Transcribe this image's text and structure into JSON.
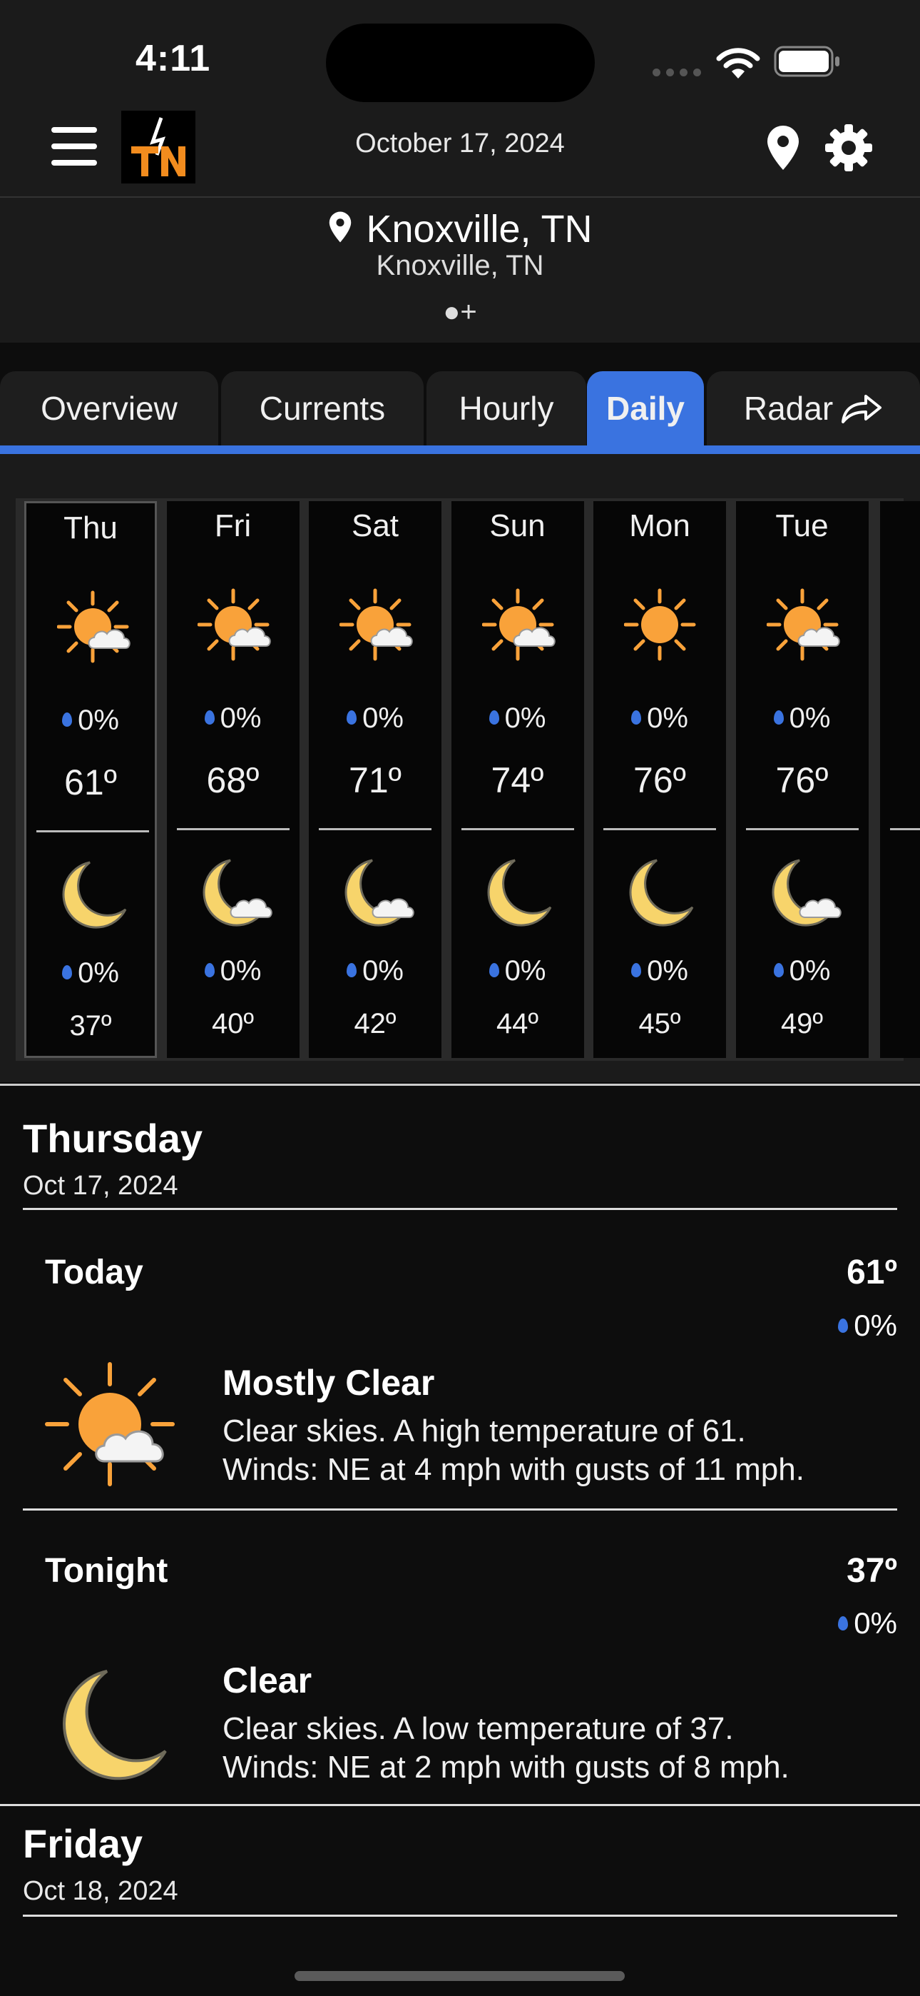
{
  "status": {
    "time": "4:11"
  },
  "header": {
    "date": "October 17, 2024"
  },
  "location": {
    "name": "Knoxville, TN",
    "subname": "Knoxville, TN",
    "pager": "●+"
  },
  "tabs": [
    {
      "label": "Overview",
      "active": false
    },
    {
      "label": "Currents",
      "active": false
    },
    {
      "label": "Hourly",
      "active": false
    },
    {
      "label": "Daily",
      "active": true
    },
    {
      "label": "Radar",
      "active": false
    }
  ],
  "days": [
    {
      "day": "Thu",
      "day_icon": "sun-cloud",
      "day_rain": "0%",
      "high": "61º",
      "night_icon": "moon",
      "night_rain": "0%",
      "low": "37º"
    },
    {
      "day": "Fri",
      "day_icon": "sun-cloud",
      "day_rain": "0%",
      "high": "68º",
      "night_icon": "moon-cloud",
      "night_rain": "0%",
      "low": "40º"
    },
    {
      "day": "Sat",
      "day_icon": "sun-cloud",
      "day_rain": "0%",
      "high": "71º",
      "night_icon": "moon-cloud",
      "night_rain": "0%",
      "low": "42º"
    },
    {
      "day": "Sun",
      "day_icon": "sun-cloud",
      "day_rain": "0%",
      "high": "74º",
      "night_icon": "moon",
      "night_rain": "0%",
      "low": "44º"
    },
    {
      "day": "Mon",
      "day_icon": "sun",
      "day_rain": "0%",
      "high": "76º",
      "night_icon": "moon",
      "night_rain": "0%",
      "low": "45º"
    },
    {
      "day": "Tue",
      "day_icon": "sun-cloud",
      "day_rain": "0%",
      "high": "76º",
      "night_icon": "moon-cloud",
      "night_rain": "0%",
      "low": "49º"
    }
  ],
  "detail": {
    "thursday": {
      "title": "Thursday",
      "date": "Oct 17, 2024",
      "today": {
        "label": "Today",
        "temp": "61º",
        "rain": "0%",
        "condition": "Mostly Clear",
        "line1": "Clear skies. A high temperature of 61.",
        "line2": "Winds: NE at 4 mph with gusts of 11 mph."
      },
      "tonight": {
        "label": "Tonight",
        "temp": "37º",
        "rain": "0%",
        "condition": "Clear",
        "line1": "Clear skies. A low temperature of 37.",
        "line2": "Winds: NE at 2 mph with gusts of 8 mph."
      }
    },
    "friday": {
      "title": "Friday",
      "date": "Oct 18, 2024"
    }
  },
  "colors": {
    "accent": "#3a73e0",
    "sun": "#f9a23a",
    "moon": "#f7d46b",
    "background": "#0d0d0d"
  }
}
